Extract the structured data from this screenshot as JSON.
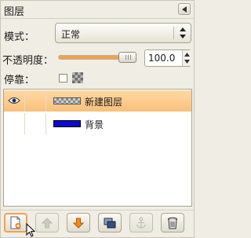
{
  "dialog": {
    "title": "图层",
    "menu_icon": "triangle-left-icon"
  },
  "mode": {
    "label": "模式：",
    "value": "正常"
  },
  "opacity": {
    "label": "不透明度：",
    "value": "100.0",
    "level_percent": 100,
    "accent_color": "#f0a24c"
  },
  "lock": {
    "label": "停靠：",
    "checked": false,
    "icon": "alpha-checker-icon"
  },
  "layers": [
    {
      "name": "新建图层",
      "visible": true,
      "selected": true,
      "thumbnail": "transparent-checker"
    },
    {
      "name": "背景",
      "visible": false,
      "selected": false,
      "thumbnail": "#0a0acc"
    }
  ],
  "toolbar": [
    {
      "icon": "new-layer-icon",
      "enabled": true,
      "focused": true
    },
    {
      "icon": "raise-layer-icon",
      "enabled": false
    },
    {
      "icon": "lower-layer-icon",
      "enabled": true
    },
    {
      "icon": "duplicate-layer-icon",
      "enabled": true
    },
    {
      "icon": "anchor-layer-icon",
      "enabled": false
    },
    {
      "icon": "delete-layer-icon",
      "enabled": true
    }
  ],
  "colors": {
    "background": "#f0ede4",
    "selection": "#f8c07c",
    "arrow_orange": "#f08a1c"
  }
}
